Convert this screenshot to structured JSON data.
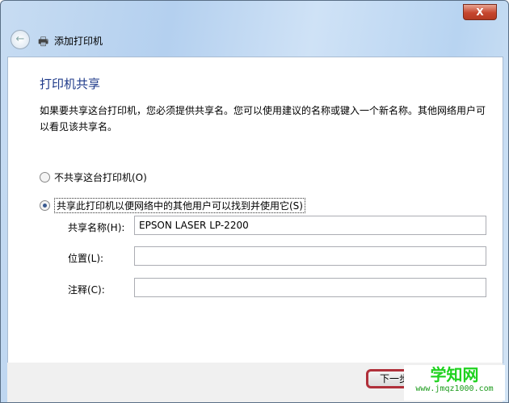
{
  "window": {
    "title": "添加打印机",
    "close_label": "X"
  },
  "heading": "打印机共享",
  "description": "如果要共享这台打印机，您必须提供共享名。您可以使用建议的名称或键入一个新名称。其他网络用户可以看见该共享名。",
  "options": [
    {
      "label": "不共享这台打印机(O)",
      "selected": false
    },
    {
      "label": "共享此打印机以便网络中的其他用户可以找到并使用它(S)",
      "selected": true
    }
  ],
  "fields": [
    {
      "label": "共享名称(H):",
      "value": "EPSON LASER LP-2200"
    },
    {
      "label": "位置(L):",
      "value": ""
    },
    {
      "label": "注释(C):",
      "value": ""
    }
  ],
  "buttons": {
    "next": "下一步(N)"
  },
  "watermark": {
    "name": "学知网",
    "url": "www.jmqz1000.com"
  }
}
